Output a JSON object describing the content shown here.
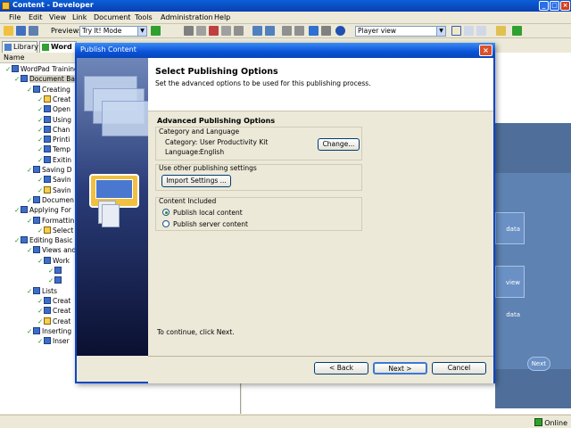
{
  "app": {
    "title": "Content - Developer"
  },
  "menu": [
    "File",
    "Edit",
    "View",
    "Link",
    "Document",
    "Tools",
    "Administration",
    "Help"
  ],
  "toolbar": {
    "preview_label": "Preview:",
    "preview_value": "Try It! Mode",
    "view_value": "Player view"
  },
  "tabs": [
    {
      "label": "Library"
    },
    {
      "label": "Word"
    }
  ],
  "tree": {
    "header": "Name",
    "rows": [
      {
        "text": "WordPad Training",
        "icon": "book"
      },
      {
        "text": "Document Ba",
        "icon": "book"
      },
      {
        "text": "Creating",
        "icon": "book"
      },
      {
        "text": "Creat",
        "icon": "topic"
      },
      {
        "text": "Open",
        "icon": "page"
      },
      {
        "text": "Using",
        "icon": "page"
      },
      {
        "text": "Chan",
        "icon": "page"
      },
      {
        "text": "Printi",
        "icon": "page"
      },
      {
        "text": "Temp",
        "icon": "page"
      },
      {
        "text": "Exitin",
        "icon": "page"
      },
      {
        "text": "Saving D",
        "icon": "book"
      },
      {
        "text": "Savin",
        "icon": "page"
      },
      {
        "text": "Savin",
        "icon": "topic"
      },
      {
        "text": "Documen",
        "icon": "page"
      },
      {
        "text": "Applying For",
        "icon": "book"
      },
      {
        "text": "Formattin",
        "icon": "book"
      },
      {
        "text": "Select",
        "icon": "topic"
      },
      {
        "text": "Editing Basic",
        "icon": "book"
      },
      {
        "text": "Views and",
        "icon": "book"
      },
      {
        "text": "Work",
        "icon": "book"
      },
      {
        "text": "",
        "icon": "page"
      },
      {
        "text": "",
        "icon": "page"
      },
      {
        "text": "Lists",
        "icon": "book"
      },
      {
        "text": "Creat",
        "icon": "page"
      },
      {
        "text": "Creat",
        "icon": "page"
      },
      {
        "text": "Creat",
        "icon": "topic"
      },
      {
        "text": "Inserting",
        "icon": "book"
      },
      {
        "text": "Inser",
        "icon": "page"
      }
    ]
  },
  "player": {
    "btn1": "data",
    "btn2": "view data",
    "next": "Next"
  },
  "status": {
    "online": "Online"
  },
  "dialog": {
    "title": "Publish Content",
    "heading": "Select Publishing Options",
    "subheading": "Set the advanced options to be used for this publishing process.",
    "section_title": "Advanced Publishing Options",
    "category_group": "Category and Language",
    "category_label": "Category:",
    "category_value": "User Productivity Kit",
    "language_label": "Language:",
    "language_value": "English",
    "change_button": "Change...",
    "other_settings_group": "Use other publishing settings",
    "import_button": "Import Settings ...",
    "content_group": "Content Included",
    "radio_local": "Publish local content",
    "radio_server": "Publish server content",
    "continue_text": "To continue, click Next.",
    "back_button": "< Back",
    "next_button": "Next >",
    "cancel_button": "Cancel"
  }
}
